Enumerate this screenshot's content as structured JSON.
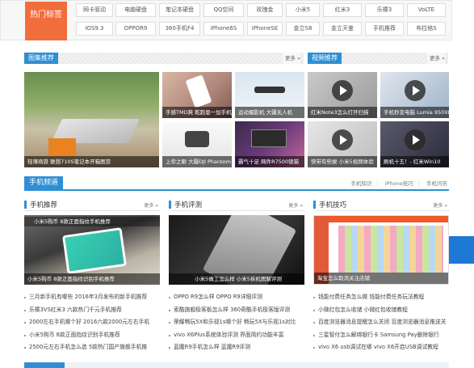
{
  "hot_tags": {
    "label": "热门标签",
    "row1": [
      "网卡驱动",
      "电脑硬盘",
      "笔记本硬盘",
      "QQ空间",
      "玫瑰金",
      "小米5",
      "红米3",
      "乐檬3",
      "VoLTE"
    ],
    "row2": [
      "iOS9.3",
      "OPPOR9",
      "360手机F4",
      "iPhone6S",
      "iPhoneSE",
      "金立S8",
      "金立天鉴",
      "手机推荐",
      "布拉格S"
    ]
  },
  "image_recommend": {
    "title": "图集推荐",
    "more": "更多 »",
    "big_caption": "轻薄商旅 联想710S笔记本开箱图赏",
    "items": [
      "手感TMD爽 乾跑恩一加手机",
      "运动摄影机 大疆无人机",
      "上帝之眼 大疆DJI Phantom",
      "霸气十足 网件R7500银猫"
    ]
  },
  "video_recommend": {
    "title": "视频推荐",
    "more": "更多 »",
    "items": [
      "红米Note3怎么打开扫描",
      "手机秒变电脑 Lumia 950XL",
      "快带有些娱 小米5视频体验",
      "刷机十五！- 红米Win10"
    ]
  },
  "channel": {
    "title": "手机频道",
    "links": [
      "手机知识",
      "iPhone技巧",
      "手机问答"
    ]
  },
  "columns": [
    {
      "title": "手机推荐",
      "more": "更多 »",
      "img_top_caption": "小米5购币 8款正面指纹手机推荐",
      "img_caption": "小米5购币 8款正面指纹识别手机推荐",
      "list": [
        "三月新手机有哪些 2016年3月发布的新手机推荐",
        "乐檬3VS红米3 六款热门千元手机推荐",
        "2000左右手机哪个好 2016六款2000元左右手机",
        "小米5购币 8款正面指纹识别手机推荐",
        "2500元左右手机怎么选 5款热门国产旗舰手机推"
      ]
    },
    {
      "title": "手机评测",
      "more": "更多 »",
      "img_caption": "小米5做工怎么样 小米5拆机图解评测",
      "list": [
        "OPPO R9怎么样 OPPO R9详细评测",
        "索酷旗舰极客板怎么样 360奇酷手机极客版评测",
        "荣耀畅玩5X和乐视1s哪个好 畅玩5X与乐视1s对比",
        "vivo X6Plus系统体验评测 界面简约功能丰富",
        "蓝魔R9手机怎么样 蓝魔R9评测"
      ]
    },
    {
      "title": "手机技巧",
      "more": "更多 »",
      "img_caption": "淘宝怎么取消关注店铺",
      "list": [
        "钱能付费任务怎么做 钱能付费任务玩法教程",
        "小微红包怎么收储 小微红包收储教程",
        "百度浏览器消息提醒怎么关闭 百度浏览器消息推送关",
        "三星智付怎么解绑银行卡 Samsung Pay删除银行",
        "vivo X6 usb调试在哪 vivo X6开启USB调试教程"
      ]
    }
  ],
  "colors": {
    "accent": "#2e8fd4",
    "hot": "#f26d3d",
    "side_block": "#1e78d6"
  }
}
